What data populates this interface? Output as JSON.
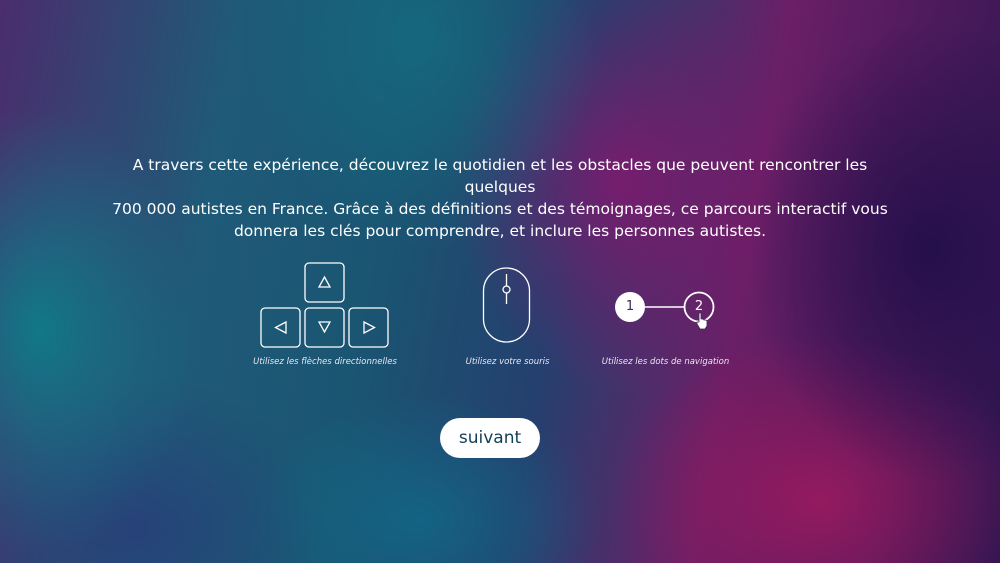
{
  "intro": {
    "line1": "A travers cette expérience, découvrez le quotidien et les obstacles que peuvent rencontrer les quelques",
    "line2": "700 000 autistes en France. Grâce à des définitions et des témoignages, ce parcours interactif vous",
    "line3": "donnera les clés pour comprendre, et inclure les personnes autistes."
  },
  "help": {
    "keys_caption": "Utilisez les flèches directionnelles",
    "mouse_caption": "Utilisez  votre souris",
    "dots_caption": "Utilisez les dots de navigation",
    "dot1_label": "1",
    "dot2_label": "2"
  },
  "actions": {
    "next_label": "suivant"
  },
  "icons": [
    "arrow-keys-icon",
    "mouse-icon",
    "navigation-dots-icon",
    "hand-cursor-icon"
  ]
}
